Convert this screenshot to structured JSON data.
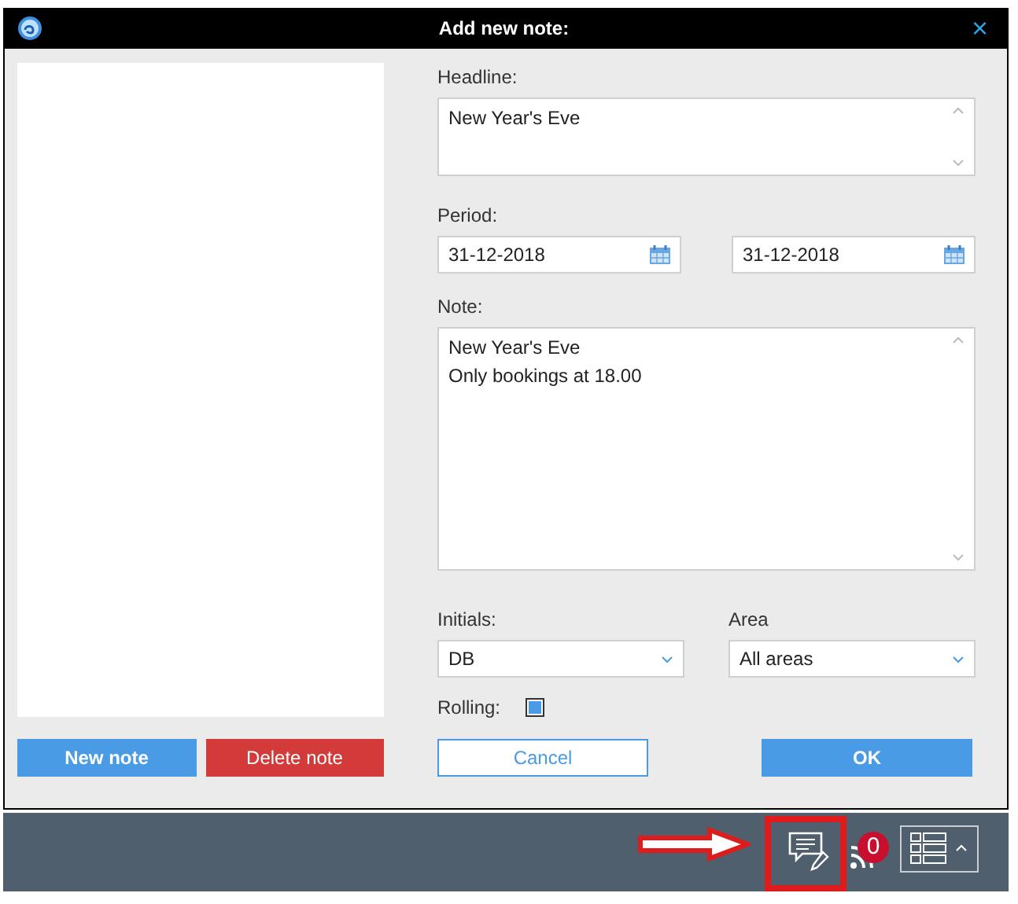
{
  "window": {
    "title": "Add new note:",
    "close": "×"
  },
  "form": {
    "headline": {
      "label": "Headline:",
      "value": "New Year's Eve"
    },
    "period": {
      "label": "Period:",
      "from": "31-12-2018",
      "to": "31-12-2018"
    },
    "note": {
      "label": "Note:",
      "value": "New Year's Eve\nOnly bookings at 18.00"
    },
    "initials": {
      "label": "Initials:",
      "value": "DB"
    },
    "area": {
      "label": "Area",
      "value": "All areas"
    },
    "rolling": {
      "label": "Rolling:",
      "checked": true
    }
  },
  "list_buttons": [
    {
      "label": "New note",
      "kind": "primary"
    },
    {
      "label": "Delete note",
      "kind": "danger"
    }
  ],
  "dialog_buttons": [
    {
      "label": "Cancel",
      "kind": "outline"
    },
    {
      "label": "OK",
      "kind": "primary"
    }
  ],
  "footer": {
    "notification_count": "0"
  }
}
